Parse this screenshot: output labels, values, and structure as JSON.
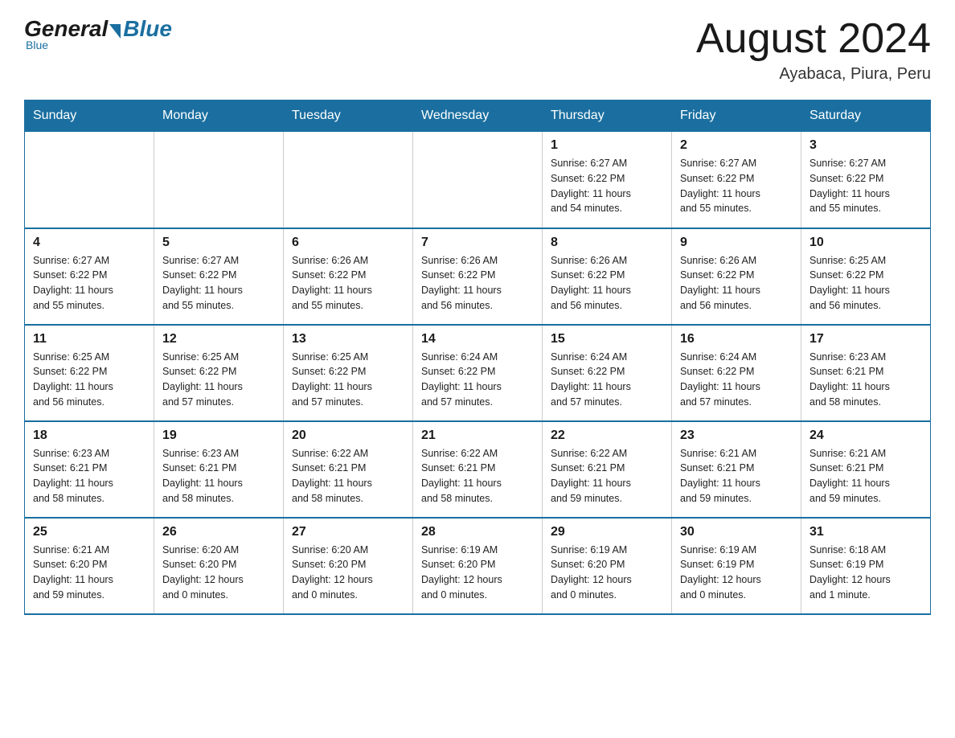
{
  "header": {
    "logo_general": "General",
    "logo_blue": "Blue",
    "month_title": "August 2024",
    "location": "Ayabaca, Piura, Peru"
  },
  "days_of_week": [
    "Sunday",
    "Monday",
    "Tuesday",
    "Wednesday",
    "Thursday",
    "Friday",
    "Saturday"
  ],
  "weeks": [
    [
      {
        "num": "",
        "info": ""
      },
      {
        "num": "",
        "info": ""
      },
      {
        "num": "",
        "info": ""
      },
      {
        "num": "",
        "info": ""
      },
      {
        "num": "1",
        "info": "Sunrise: 6:27 AM\nSunset: 6:22 PM\nDaylight: 11 hours\nand 54 minutes."
      },
      {
        "num": "2",
        "info": "Sunrise: 6:27 AM\nSunset: 6:22 PM\nDaylight: 11 hours\nand 55 minutes."
      },
      {
        "num": "3",
        "info": "Sunrise: 6:27 AM\nSunset: 6:22 PM\nDaylight: 11 hours\nand 55 minutes."
      }
    ],
    [
      {
        "num": "4",
        "info": "Sunrise: 6:27 AM\nSunset: 6:22 PM\nDaylight: 11 hours\nand 55 minutes."
      },
      {
        "num": "5",
        "info": "Sunrise: 6:27 AM\nSunset: 6:22 PM\nDaylight: 11 hours\nand 55 minutes."
      },
      {
        "num": "6",
        "info": "Sunrise: 6:26 AM\nSunset: 6:22 PM\nDaylight: 11 hours\nand 55 minutes."
      },
      {
        "num": "7",
        "info": "Sunrise: 6:26 AM\nSunset: 6:22 PM\nDaylight: 11 hours\nand 56 minutes."
      },
      {
        "num": "8",
        "info": "Sunrise: 6:26 AM\nSunset: 6:22 PM\nDaylight: 11 hours\nand 56 minutes."
      },
      {
        "num": "9",
        "info": "Sunrise: 6:26 AM\nSunset: 6:22 PM\nDaylight: 11 hours\nand 56 minutes."
      },
      {
        "num": "10",
        "info": "Sunrise: 6:25 AM\nSunset: 6:22 PM\nDaylight: 11 hours\nand 56 minutes."
      }
    ],
    [
      {
        "num": "11",
        "info": "Sunrise: 6:25 AM\nSunset: 6:22 PM\nDaylight: 11 hours\nand 56 minutes."
      },
      {
        "num": "12",
        "info": "Sunrise: 6:25 AM\nSunset: 6:22 PM\nDaylight: 11 hours\nand 57 minutes."
      },
      {
        "num": "13",
        "info": "Sunrise: 6:25 AM\nSunset: 6:22 PM\nDaylight: 11 hours\nand 57 minutes."
      },
      {
        "num": "14",
        "info": "Sunrise: 6:24 AM\nSunset: 6:22 PM\nDaylight: 11 hours\nand 57 minutes."
      },
      {
        "num": "15",
        "info": "Sunrise: 6:24 AM\nSunset: 6:22 PM\nDaylight: 11 hours\nand 57 minutes."
      },
      {
        "num": "16",
        "info": "Sunrise: 6:24 AM\nSunset: 6:22 PM\nDaylight: 11 hours\nand 57 minutes."
      },
      {
        "num": "17",
        "info": "Sunrise: 6:23 AM\nSunset: 6:21 PM\nDaylight: 11 hours\nand 58 minutes."
      }
    ],
    [
      {
        "num": "18",
        "info": "Sunrise: 6:23 AM\nSunset: 6:21 PM\nDaylight: 11 hours\nand 58 minutes."
      },
      {
        "num": "19",
        "info": "Sunrise: 6:23 AM\nSunset: 6:21 PM\nDaylight: 11 hours\nand 58 minutes."
      },
      {
        "num": "20",
        "info": "Sunrise: 6:22 AM\nSunset: 6:21 PM\nDaylight: 11 hours\nand 58 minutes."
      },
      {
        "num": "21",
        "info": "Sunrise: 6:22 AM\nSunset: 6:21 PM\nDaylight: 11 hours\nand 58 minutes."
      },
      {
        "num": "22",
        "info": "Sunrise: 6:22 AM\nSunset: 6:21 PM\nDaylight: 11 hours\nand 59 minutes."
      },
      {
        "num": "23",
        "info": "Sunrise: 6:21 AM\nSunset: 6:21 PM\nDaylight: 11 hours\nand 59 minutes."
      },
      {
        "num": "24",
        "info": "Sunrise: 6:21 AM\nSunset: 6:21 PM\nDaylight: 11 hours\nand 59 minutes."
      }
    ],
    [
      {
        "num": "25",
        "info": "Sunrise: 6:21 AM\nSunset: 6:20 PM\nDaylight: 11 hours\nand 59 minutes."
      },
      {
        "num": "26",
        "info": "Sunrise: 6:20 AM\nSunset: 6:20 PM\nDaylight: 12 hours\nand 0 minutes."
      },
      {
        "num": "27",
        "info": "Sunrise: 6:20 AM\nSunset: 6:20 PM\nDaylight: 12 hours\nand 0 minutes."
      },
      {
        "num": "28",
        "info": "Sunrise: 6:19 AM\nSunset: 6:20 PM\nDaylight: 12 hours\nand 0 minutes."
      },
      {
        "num": "29",
        "info": "Sunrise: 6:19 AM\nSunset: 6:20 PM\nDaylight: 12 hours\nand 0 minutes."
      },
      {
        "num": "30",
        "info": "Sunrise: 6:19 AM\nSunset: 6:19 PM\nDaylight: 12 hours\nand 0 minutes."
      },
      {
        "num": "31",
        "info": "Sunrise: 6:18 AM\nSunset: 6:19 PM\nDaylight: 12 hours\nand 1 minute."
      }
    ]
  ]
}
